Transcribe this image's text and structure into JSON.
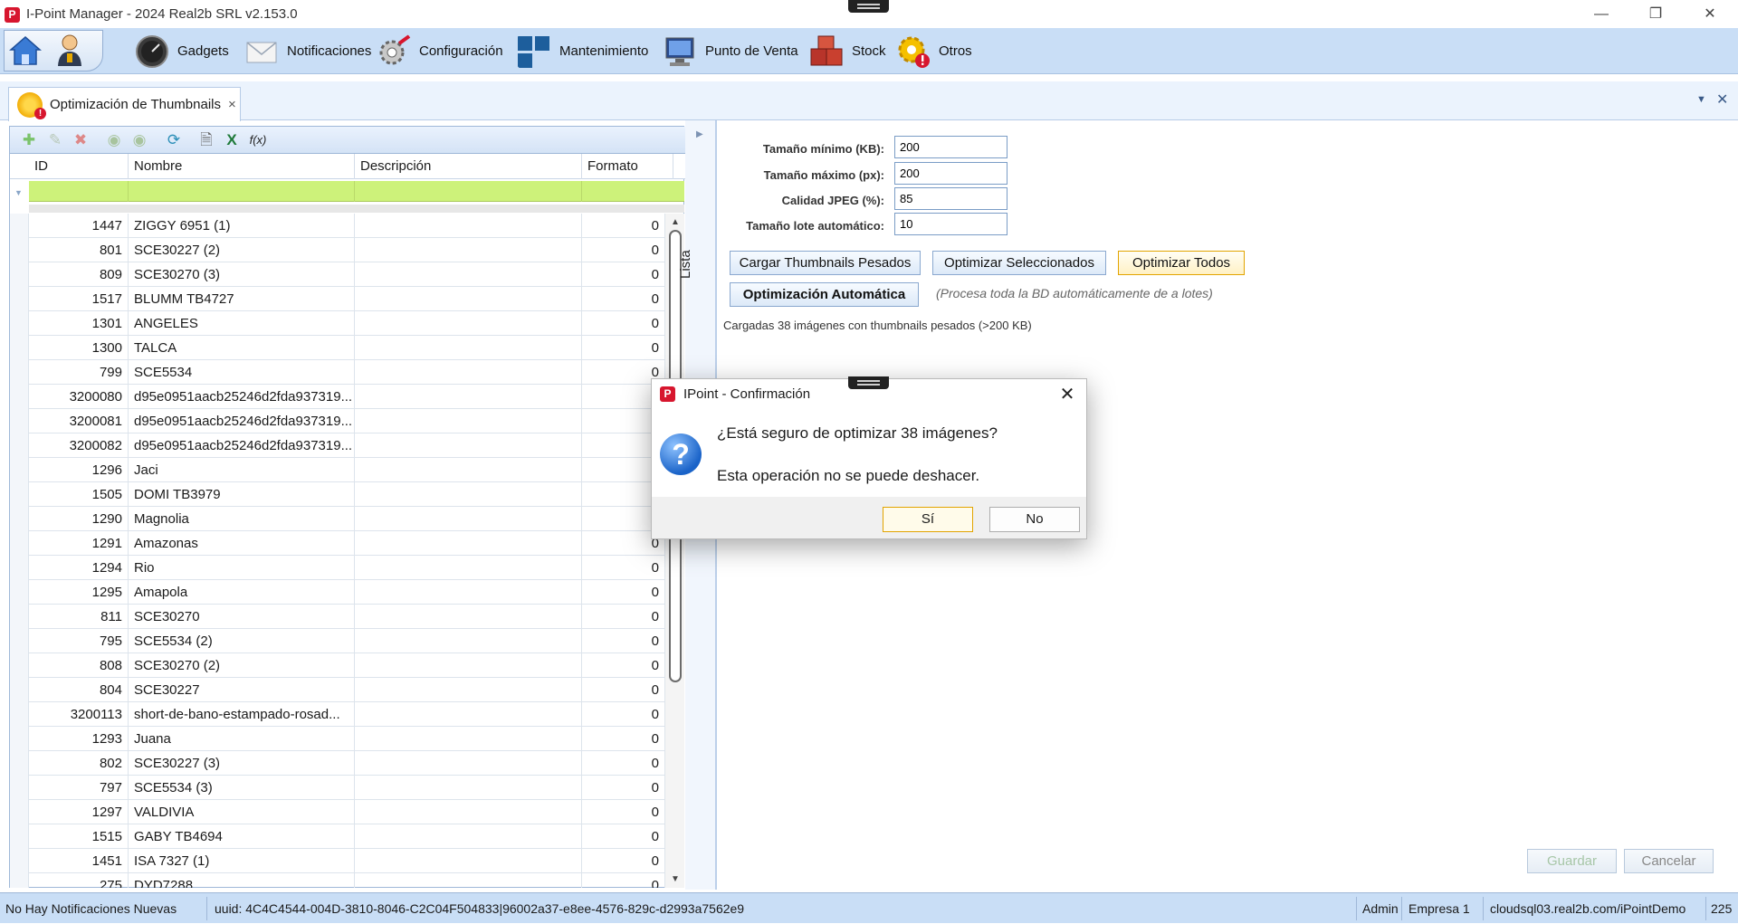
{
  "window": {
    "title": "I-Point Manager - 2024 Real2b SRL v2.153.0",
    "logo_text": "P",
    "controls": [
      "—",
      "❐",
      "✕"
    ]
  },
  "toolbar": {
    "items": [
      {
        "label": "Gadgets",
        "icon": "gauge-icon"
      },
      {
        "label": "Notificaciones",
        "icon": "envelope-icon"
      },
      {
        "label": "Configuración",
        "icon": "wrench-gear-icon"
      },
      {
        "label": "Mantenimiento",
        "icon": "blue-blocks-icon"
      },
      {
        "label": "Punto de Venta",
        "icon": "monitor-icon"
      },
      {
        "label": "Stock",
        "icon": "boxes-icon"
      },
      {
        "label": "Otros",
        "icon": "gear-alert-icon"
      }
    ]
  },
  "tab": {
    "label": "Optimización de Thumbnails",
    "close": "×",
    "badge": "!"
  },
  "grid": {
    "columns": [
      "ID",
      "Nombre",
      "Descripción",
      "Formato"
    ],
    "rows": [
      {
        "id": "1447",
        "name": "ZIGGY 6951 (1)",
        "desc": "",
        "fmt": "0"
      },
      {
        "id": "801",
        "name": "SCE30227 (2)",
        "desc": "",
        "fmt": "0"
      },
      {
        "id": "809",
        "name": "SCE30270 (3)",
        "desc": "",
        "fmt": "0"
      },
      {
        "id": "1517",
        "name": "BLUMM TB4727",
        "desc": "",
        "fmt": "0"
      },
      {
        "id": "1301",
        "name": "ANGELES",
        "desc": "",
        "fmt": "0"
      },
      {
        "id": "1300",
        "name": "TALCA",
        "desc": "",
        "fmt": "0"
      },
      {
        "id": "799",
        "name": "SCE5534",
        "desc": "",
        "fmt": "0"
      },
      {
        "id": "3200080",
        "name": "d95e0951aacb25246d2fda937319...",
        "desc": "",
        "fmt": ""
      },
      {
        "id": "3200081",
        "name": "d95e0951aacb25246d2fda937319...",
        "desc": "",
        "fmt": ""
      },
      {
        "id": "3200082",
        "name": "d95e0951aacb25246d2fda937319...",
        "desc": "",
        "fmt": ""
      },
      {
        "id": "1296",
        "name": "Jaci",
        "desc": "",
        "fmt": ""
      },
      {
        "id": "1505",
        "name": "DOMI TB3979",
        "desc": "",
        "fmt": ""
      },
      {
        "id": "1290",
        "name": "Magnolia",
        "desc": "",
        "fmt": ""
      },
      {
        "id": "1291",
        "name": "Amazonas",
        "desc": "",
        "fmt": "0"
      },
      {
        "id": "1294",
        "name": "Rio",
        "desc": "",
        "fmt": "0"
      },
      {
        "id": "1295",
        "name": "Amapola",
        "desc": "",
        "fmt": "0"
      },
      {
        "id": "811",
        "name": "SCE30270",
        "desc": "",
        "fmt": "0"
      },
      {
        "id": "795",
        "name": "SCE5534 (2)",
        "desc": "",
        "fmt": "0"
      },
      {
        "id": "808",
        "name": "SCE30270 (2)",
        "desc": "",
        "fmt": "0"
      },
      {
        "id": "804",
        "name": "SCE30227",
        "desc": "",
        "fmt": "0"
      },
      {
        "id": "3200113",
        "name": "short-de-bano-estampado-rosad...",
        "desc": "",
        "fmt": "0"
      },
      {
        "id": "1293",
        "name": "Juana",
        "desc": "",
        "fmt": "0"
      },
      {
        "id": "802",
        "name": "SCE30227 (3)",
        "desc": "",
        "fmt": "0"
      },
      {
        "id": "797",
        "name": "SCE5534 (3)",
        "desc": "",
        "fmt": "0"
      },
      {
        "id": "1297",
        "name": "VALDIVIA",
        "desc": "",
        "fmt": "0"
      },
      {
        "id": "1515",
        "name": "GABY TB4694",
        "desc": "",
        "fmt": "0"
      },
      {
        "id": "1451",
        "name": "ISA 7327 (1)",
        "desc": "",
        "fmt": "0"
      },
      {
        "id": "275",
        "name": "DYD7288",
        "desc": "",
        "fmt": "0"
      }
    ]
  },
  "side_label": "Lista",
  "form": {
    "fields": [
      {
        "label": "Tamaño mínimo (KB):",
        "value": "200"
      },
      {
        "label": "Tamaño máximo (px):",
        "value": "200"
      },
      {
        "label": "Calidad JPEG (%):",
        "value": "85"
      },
      {
        "label": "Tamaño lote automático:",
        "value": "10"
      }
    ],
    "buttons": {
      "load": "Cargar Thumbnails Pesados",
      "optimize_selected": "Optimizar Seleccionados",
      "optimize_all": "Optimizar Todos",
      "auto": "Optimización Automática"
    },
    "auto_note": "(Procesa toda la BD automáticamente de a lotes)",
    "load_message": "Cargadas 38 imágenes con thumbnails pesados (>200 KB)",
    "save": "Guardar",
    "cancel": "Cancelar"
  },
  "status": {
    "notifications": "No Hay Notificaciones Nuevas",
    "uuid": "uuid: 4C4C4544-004D-3810-8046-C2C04F504833|96002a37-e8ee-4576-829c-d2993a7562e9",
    "user": "Admin",
    "company": "Empresa 1",
    "server": "cloudsql03.real2b.com/iPointDemo",
    "num": "225"
  },
  "dialog": {
    "title": "IPoint - Confirmación",
    "line1": "¿Está seguro de optimizar 38 imágenes?",
    "line2": "Esta operación no se puede deshacer.",
    "yes": "Sí",
    "no": "No"
  }
}
